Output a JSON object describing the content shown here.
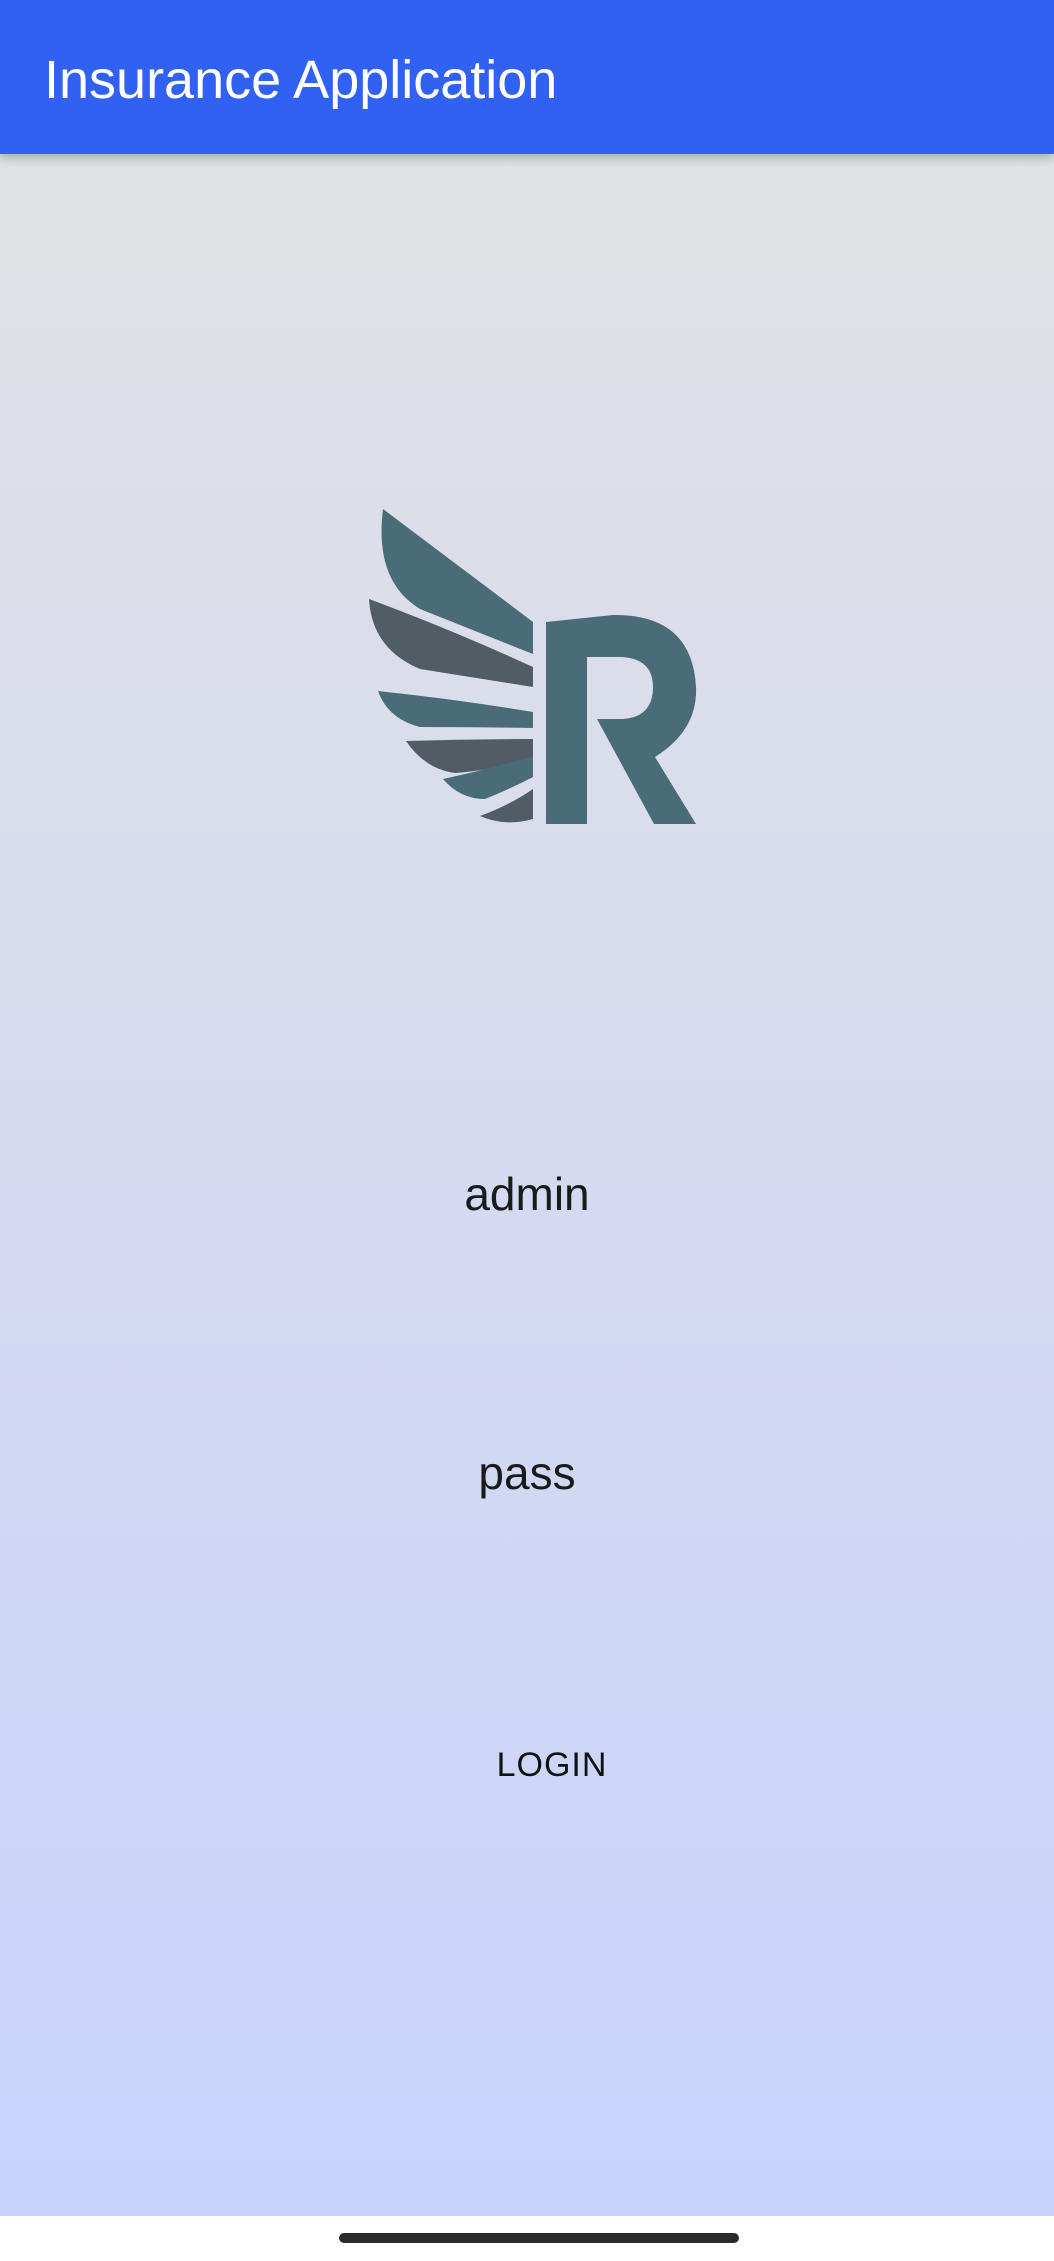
{
  "app_bar": {
    "title": "Insurance Application",
    "color": "#3061f2"
  },
  "logo": {
    "icon": "winged-r-logo-icon",
    "colors": {
      "primary": "#4a6b78",
      "secondary": "#515c64"
    }
  },
  "login_form": {
    "username_value": "admin",
    "password_value": "pass",
    "login_label": "LOGIN"
  },
  "background": {
    "gradient_top": "#e1e2e4",
    "gradient_bottom": "#c7d3fc"
  },
  "system_nav": {
    "home_indicator": "home-indicator-bar"
  }
}
